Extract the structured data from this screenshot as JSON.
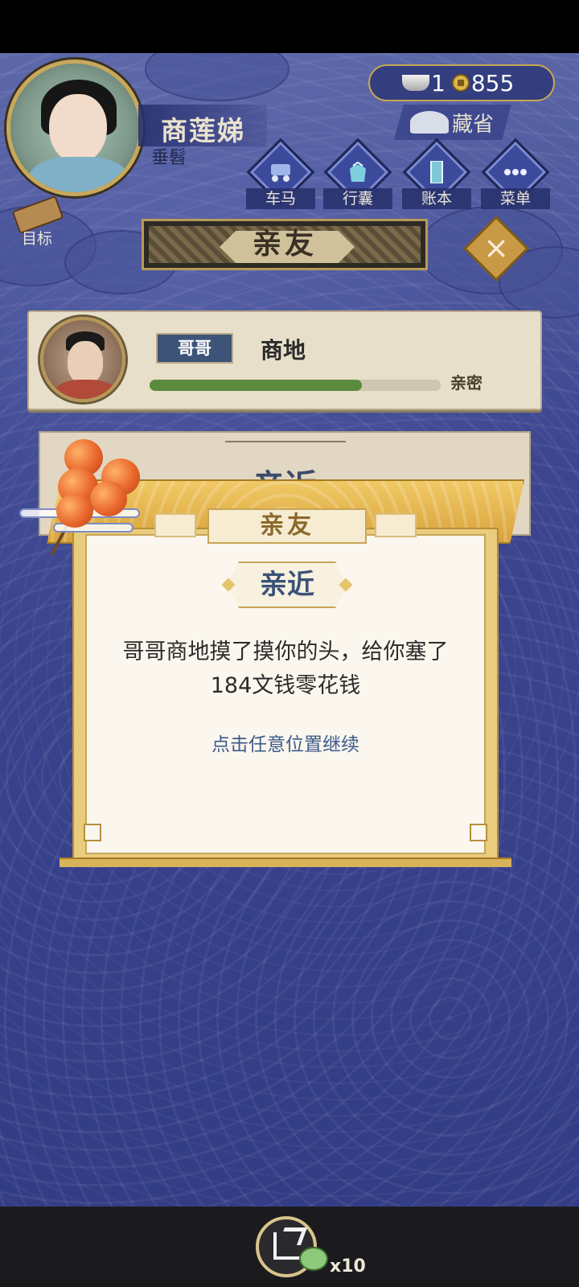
{
  "header": {
    "character_name": "商莲娣",
    "character_title": "垂髫",
    "currency": {
      "ingot": "1",
      "coins": "855"
    },
    "zangsheng_label": "藏省",
    "menu": [
      {
        "label": "车马",
        "icon": "carriage-icon"
      },
      {
        "label": "行囊",
        "icon": "bundle-icon"
      },
      {
        "label": "账本",
        "icon": "ledger-icon"
      },
      {
        "label": "菜单",
        "icon": "more-icon"
      }
    ],
    "target_label": "目标"
  },
  "page": {
    "title": "亲友"
  },
  "relative": {
    "relation": "哥哥",
    "name": "商地",
    "intimacy_label": "亲密",
    "intimacy_progress": 0.73
  },
  "background_card": {
    "title": "亲近"
  },
  "popup": {
    "tab_title": "亲友",
    "event_title": "亲近",
    "message_line1": "哥哥商地摸了摸你的头，给你塞了",
    "message_line2": "184文钱零花钱",
    "hint": "点击任意位置继续"
  },
  "bottom": {
    "reward_count": "x10"
  },
  "colors": {
    "accent_gold": "#c9a653",
    "bg_navy": "#3c4690",
    "progress_green": "#5a8b3c",
    "hint_blue": "#3d5a8b"
  }
}
